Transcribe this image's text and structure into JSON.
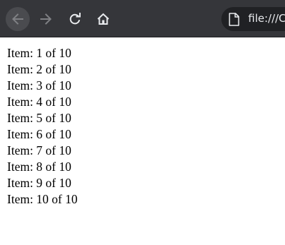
{
  "browser": {
    "address_bar": {
      "url_text": "file:///C"
    }
  },
  "page": {
    "items": [
      "Item: 1 of 10",
      "Item: 2 of 10",
      "Item: 3 of 10",
      "Item: 4 of 10",
      "Item: 5 of 10",
      "Item: 6 of 10",
      "Item: 7 of 10",
      "Item: 8 of 10",
      "Item: 9 of 10",
      "Item: 10 of 10"
    ]
  },
  "colors": {
    "toolbar": "#35363a",
    "omnibox": "#202124",
    "icon": "#e8eaed",
    "icon_disabled": "#7f8084",
    "page_background": "#ffffff",
    "text": "#000000"
  },
  "icons": {
    "back": "arrow-left-icon",
    "forward": "arrow-right-icon",
    "reload": "reload-icon",
    "home": "home-icon",
    "file": "file-icon"
  }
}
